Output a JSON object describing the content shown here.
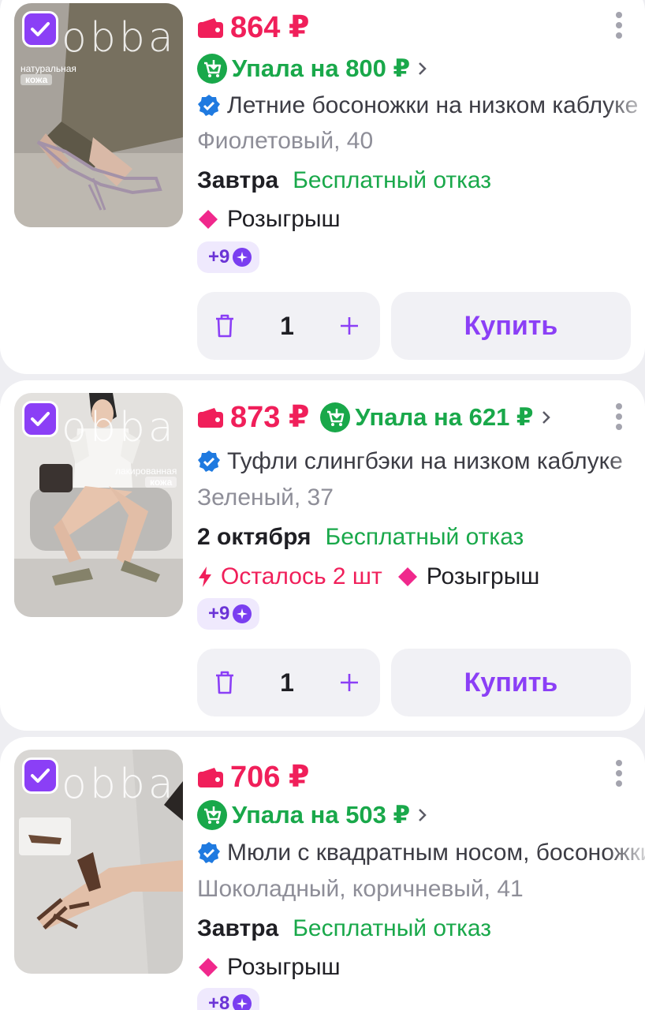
{
  "colors": {
    "accent": "#8b3ff6",
    "price": "#f01f5a",
    "success": "#19a84a",
    "verified": "#1f7ae0"
  },
  "products": [
    {
      "brand_logo": "obba",
      "image_tag_line1": "натуральная",
      "image_tag_line2": "кожа",
      "checked": true,
      "price": "864 ₽",
      "price_drop": "Упала на 800 ₽",
      "title": "Летние босоножки на низком каблуке",
      "variant": "Фиолетовый, 40",
      "delivery": "Завтра",
      "refund": "Бесплатный отказ",
      "stock": "",
      "promo": "Розыгрыш",
      "bonus": "+9",
      "quantity": "1",
      "buy_label": "Купить"
    },
    {
      "brand_logo": "obba",
      "image_tag_line1": "лакированная",
      "image_tag_line2": "кожа",
      "checked": true,
      "price": "873 ₽",
      "price_drop": "Упала на 621 ₽",
      "title": "Туфли слингбэки на низком каблуке",
      "variant": "Зеленый, 37",
      "delivery": "2 октября",
      "refund": "Бесплатный отказ",
      "stock": "Осталось 2 шт",
      "promo": "Розыгрыш",
      "bonus": "+9",
      "quantity": "1",
      "buy_label": "Купить"
    },
    {
      "brand_logo": "obba",
      "image_tag_line1": "",
      "image_tag_line2": "",
      "checked": true,
      "price": "706 ₽",
      "price_drop": "Упала на 503 ₽",
      "title": "Мюли с квадратным носом, босоножки",
      "variant": "Шоколадный, коричневый, 41",
      "delivery": "Завтра",
      "refund": "Бесплатный отказ",
      "stock": "",
      "promo": "Розыгрыш",
      "bonus": "+8",
      "quantity": "",
      "buy_label": ""
    }
  ]
}
